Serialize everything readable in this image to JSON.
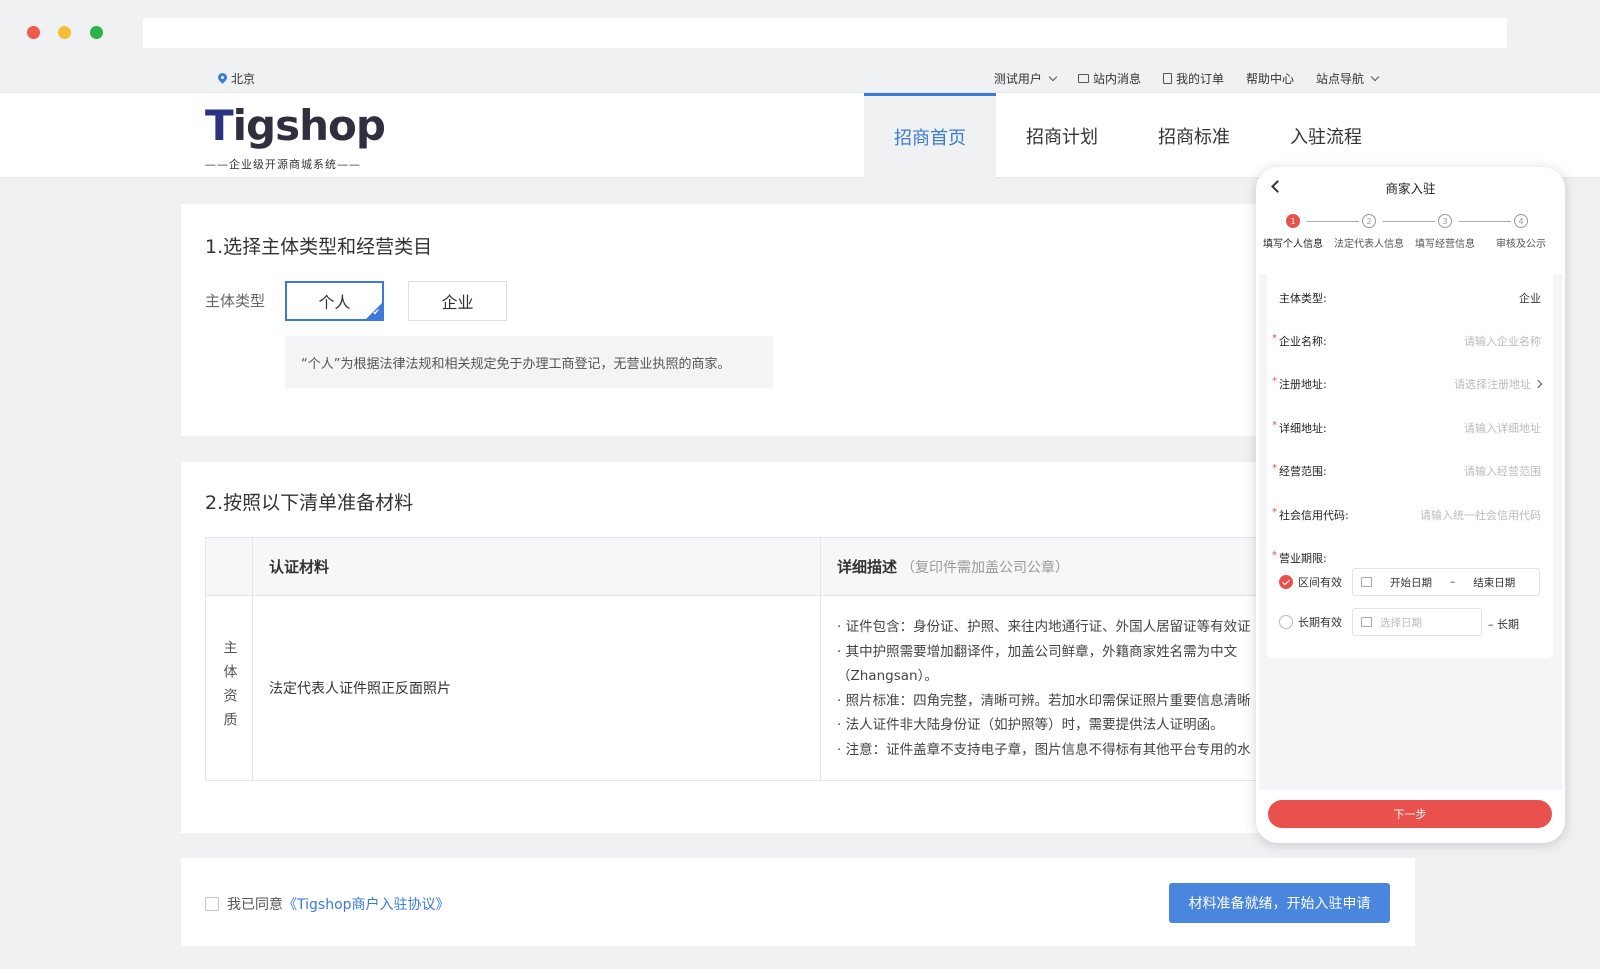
{
  "topbar": {
    "location": "北京",
    "links": [
      {
        "label": "测试用户",
        "has_dropdown": true,
        "icon": ""
      },
      {
        "label": "站内消息",
        "has_dropdown": false,
        "icon": "mail-icon"
      },
      {
        "label": "我的订单",
        "has_dropdown": false,
        "icon": "order-icon"
      },
      {
        "label": "帮助中心",
        "has_dropdown": false,
        "icon": ""
      },
      {
        "label": "站点导航",
        "has_dropdown": true,
        "icon": ""
      }
    ]
  },
  "header": {
    "logo_text": "Tigshop",
    "logo_sub": "——企业级开源商城系统——",
    "nav": [
      "招商首页",
      "招商计划",
      "招商标准",
      "入驻流程"
    ],
    "nav_active_index": 0
  },
  "section1": {
    "title": "1.选择主体类型和经营类目",
    "type_label": "主体类型",
    "options": [
      "个人",
      "企业"
    ],
    "selected": "个人",
    "note": "“个人”为根据法律法规和相关规定免于办理工商登记，无营业执照的商家。"
  },
  "section2": {
    "title": "2.按照以下清单准备材料",
    "head_material": "认证材料",
    "head_desc": "详细描述",
    "head_desc_sub": "（复印件需加盖公司公章）",
    "row_group": "主体资质",
    "row_material": "法定代表人证件照正反面照片",
    "row_desc": [
      "· 证件包含：身份证、护照、来往内地通行证、外国人居留证等有效证",
      "· 其中护照需要增加翻译件，加盖公司鲜章，外籍商家姓名需为中文",
      "（Zhangsan）。",
      "· 照片标准：四角完整，清晰可辨。若加水印需保证照片重要信息清晰",
      "· 法人证件非大陆身份证（如护照等）时，需要提供法人证明函。",
      "· 注意：证件盖章不支持电子章，图片信息不得标有其他平台专用的水"
    ]
  },
  "section3": {
    "agree_prefix": "我已同意",
    "agree_link": "《Tigshop商户入驻协议》",
    "start_button": "材料准备就绪，开始入驻申请"
  },
  "phone": {
    "title": "商家入驻",
    "steps": [
      {
        "num": "1",
        "label": "填写个人信息",
        "active": true
      },
      {
        "num": "2",
        "label": "法定代表人信息",
        "active": false
      },
      {
        "num": "3",
        "label": "填写经营信息",
        "active": false
      },
      {
        "num": "4",
        "label": "审核及公示",
        "active": false
      }
    ],
    "fields": [
      {
        "label": "主体类型:",
        "value": "企业",
        "required": false,
        "arrow": false,
        "placeholder": false
      },
      {
        "label": "企业名称:",
        "value": "请输入企业名称",
        "required": true,
        "arrow": false,
        "placeholder": true
      },
      {
        "label": "注册地址:",
        "value": "请选择注册地址",
        "required": true,
        "arrow": true,
        "placeholder": true
      },
      {
        "label": "详细地址:",
        "value": "请输入详细地址",
        "required": true,
        "arrow": false,
        "placeholder": true
      },
      {
        "label": "经营范围:",
        "value": "请输入经营范围",
        "required": true,
        "arrow": false,
        "placeholder": true
      },
      {
        "label": "社会信用代码:",
        "value": "请输入统一社会信用代码",
        "required": true,
        "arrow": false,
        "placeholder": true
      }
    ],
    "period_label": "营业期限:",
    "period_option1": "区间有效",
    "period_start": "开始日期",
    "period_sep": "–",
    "period_end": "结束日期",
    "period_option2": "长期有效",
    "period_select": "选择日期",
    "period_long": "– 长期",
    "next_button": "下一步"
  },
  "colors": {
    "accent_blue": "#3a7ad9",
    "button_blue": "#4a86de",
    "phone_red": "#e8514c"
  }
}
